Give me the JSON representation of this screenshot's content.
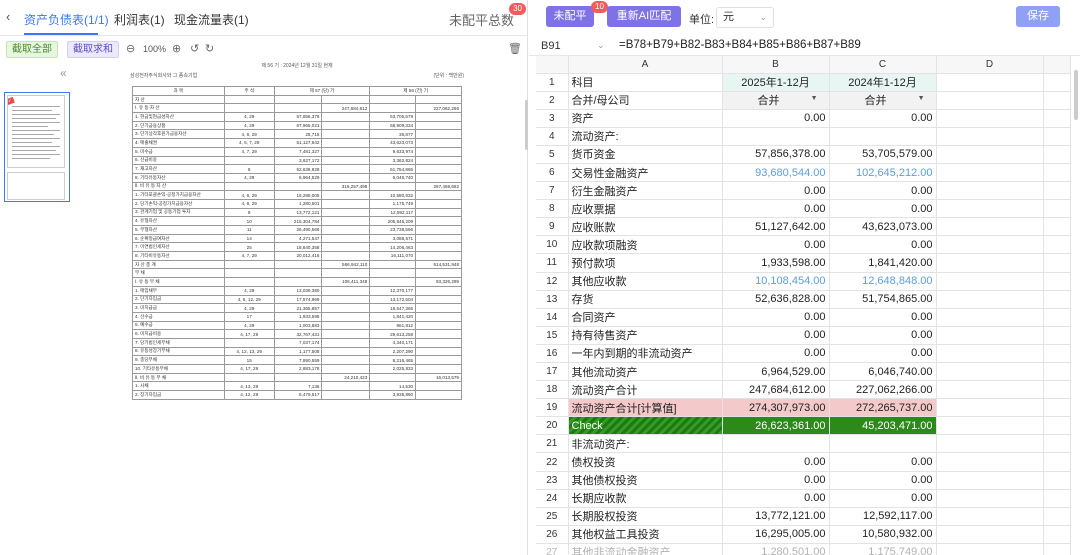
{
  "tabs": [
    {
      "label": "资产负债表(1/1)",
      "active": true
    },
    {
      "label": "利润表(1)",
      "active": false
    },
    {
      "label": "现金流量表(1)",
      "active": false
    }
  ],
  "unbalanced_label": "未配平总数",
  "unbalanced_count": "30",
  "left_toolbar": {
    "btn_all": "截取全部",
    "btn_sum": "截取求和",
    "zoom": "100%"
  },
  "document": {
    "caption": "제 56 기 : 2024년 12월 31일 현재",
    "company": "삼성전자주식회사와 그 종속기업",
    "unit": "(단위 : 백만원)",
    "header": [
      "과          목",
      "주  석",
      "제 57 (당) 기",
      "제 56 (전) 기"
    ],
    "rows": [
      [
        "자          산",
        "",
        "",
        "",
        "",
        ""
      ],
      [
        "Ⅰ. 유 동 자 산",
        "",
        "",
        "247,684,612",
        "",
        "227,062,266"
      ],
      [
        "1. 현금및현금성자산",
        "4, 29",
        "57,856,378",
        "",
        "53,705,579",
        ""
      ],
      [
        "2. 단기금융상품",
        "4, 29",
        "67,965,021",
        "",
        "58,909,334",
        ""
      ],
      [
        "3. 단기상각후원가금융자산",
        "4, 6, 29",
        "25,715",
        "",
        "36,877",
        ""
      ],
      [
        "4. 매출채권",
        "4, 5, 7, 29",
        "51,127,642",
        "",
        "43,623,073",
        ""
      ],
      [
        "5. 미수금",
        "4, 7, 29",
        "7,481,327",
        "",
        "9,633,974",
        ""
      ],
      [
        "6. 선급비용",
        "",
        "3,627,172",
        "",
        "3,362,824",
        ""
      ],
      [
        "7. 재고자산",
        "8",
        "52,636,828",
        "",
        "51,754,865",
        ""
      ],
      [
        "8. 기타유동자산",
        "4, 29",
        "6,964,529",
        "",
        "6,046,740",
        ""
      ],
      [
        "Ⅱ. 비 유 동 자 산",
        "",
        "",
        "319,257,498",
        "",
        "287,469,682"
      ],
      [
        "1. 기타포괄손익-공정가치금융자산",
        "4, 6, 29",
        "16,295,005",
        "",
        "10,580,932",
        ""
      ],
      [
        "2. 당기손익-공정가치금융자산",
        "4, 6, 29",
        "1,280,501",
        "",
        "1,175,749",
        ""
      ],
      [
        "3. 관계기업 및 공동기업 투자",
        "9",
        "13,772,121",
        "",
        "12,592,117",
        ""
      ],
      [
        "4. 유형자산",
        "10",
        "215,304,784",
        "",
        "205,945,209",
        ""
      ],
      [
        "5. 무형자산",
        "11",
        "26,490,566",
        "",
        "23,738,566",
        ""
      ],
      [
        "6. 순확정급여자산",
        "14",
        "4,271,547",
        "",
        "3,088,571",
        ""
      ],
      [
        "7. 이연법인세자산",
        "25",
        "18,840,358",
        "",
        "14,206,463",
        ""
      ],
      [
        "8. 기타비유동자산",
        "4, 7, 29",
        "20,012,416",
        "",
        "16,111,070",
        ""
      ],
      [
        "자  산  총  계",
        "",
        "",
        "566,942,110",
        "",
        "514,531,948"
      ],
      [
        "부          채",
        "",
        "",
        "",
        "",
        ""
      ],
      [
        "Ⅰ. 유 동 부 채",
        "",
        "",
        "106,411,348",
        "",
        "93,326,299"
      ],
      [
        "1. 매입채무",
        "4, 29",
        "13,039,380",
        "",
        "12,370,177",
        ""
      ],
      [
        "2. 단기차입금",
        "4, 5, 12, 29",
        "17,574,969",
        "",
        "13,172,504",
        ""
      ],
      [
        "3. 미지급금",
        "4, 29",
        "21,365,857",
        "",
        "18,547,365",
        ""
      ],
      [
        "4. 선수금",
        "17",
        "1,933,598",
        "",
        "1,841,420",
        ""
      ],
      [
        "5. 예수금",
        "4, 29",
        "1,003,883",
        "",
        "961,812",
        ""
      ],
      [
        "6. 미지급비용",
        "4, 17, 29",
        "32,767,431",
        "",
        "29,613,258",
        ""
      ],
      [
        "7. 당기법인세부채",
        "",
        "7,037,174",
        "",
        "4,340,171",
        ""
      ],
      [
        "8. 유동성장기부채",
        "4, 12, 13, 29",
        "1,177,508",
        "",
        "2,207,290",
        ""
      ],
      [
        "9. 충당부채",
        "15",
        "7,890,559",
        "",
        "8,216,465",
        ""
      ],
      [
        "10. 기타유동부채",
        "4, 17, 29",
        "2,883,178",
        "",
        "2,025,833",
        ""
      ],
      [
        "Ⅱ. 비 유 동 부 채",
        "",
        "",
        "24,210,423",
        "",
        "16,013,579"
      ],
      [
        "1. 사채",
        "4, 13, 29",
        "7,136",
        "",
        "14,530",
        ""
      ],
      [
        "2. 장기차입금",
        "4, 12, 29",
        "6,479,517",
        "",
        "3,935,860",
        ""
      ]
    ]
  },
  "right_toolbar": {
    "unbalanced_btn": "未配平",
    "unbalanced_badge": "10",
    "rematch_btn": "重新AI匹配",
    "unit_label": "单位:",
    "unit_value": "元",
    "save_btn": "保存"
  },
  "formula_bar": {
    "cell_ref": "B91",
    "formula": "=B78+B79+B82-B83+B84+B85+B86+B87+B89"
  },
  "sheet": {
    "columns": [
      "A",
      "B",
      "C",
      "D"
    ],
    "rows": [
      {
        "n": "1",
        "a": "科目",
        "b": "2025年1-12月",
        "c": "2024年1-12月",
        "style": "header"
      },
      {
        "n": "2",
        "a": "合并/母公司",
        "b": "合并",
        "c": "合并",
        "style": "dropdown"
      },
      {
        "n": "3",
        "a": "资产",
        "b": "0.00",
        "c": "0.00"
      },
      {
        "n": "4",
        "a": "流动资产:",
        "b": "",
        "c": ""
      },
      {
        "n": "5",
        "a": "货币资金",
        "b": "57,856,378.00",
        "c": "53,705,579.00"
      },
      {
        "n": "6",
        "a": "交易性金融资产",
        "b": "93,680,544.00",
        "c": "102,645,212.00",
        "style": "blue"
      },
      {
        "n": "7",
        "a": "衍生金融资产",
        "b": "0.00",
        "c": "0.00"
      },
      {
        "n": "8",
        "a": "应收票据",
        "b": "0.00",
        "c": "0.00"
      },
      {
        "n": "9",
        "a": "应收账款",
        "b": "51,127,642.00",
        "c": "43,623,073.00"
      },
      {
        "n": "10",
        "a": "应收款项融资",
        "b": "0.00",
        "c": "0.00"
      },
      {
        "n": "11",
        "a": "预付款项",
        "b": "1,933,598.00",
        "c": "1,841,420.00"
      },
      {
        "n": "12",
        "a": "其他应收款",
        "b": "10,108,454.00",
        "c": "12,648,848.00",
        "style": "blue"
      },
      {
        "n": "13",
        "a": "存货",
        "b": "52,636,828.00",
        "c": "51,754,865.00"
      },
      {
        "n": "14",
        "a": "合同资产",
        "b": "0.00",
        "c": "0.00"
      },
      {
        "n": "15",
        "a": "持有待售资产",
        "b": "0.00",
        "c": "0.00"
      },
      {
        "n": "16",
        "a": "一年内到期的非流动资产",
        "b": "0.00",
        "c": "0.00"
      },
      {
        "n": "17",
        "a": "其他流动资产",
        "b": "6,964,529.00",
        "c": "6,046,740.00"
      },
      {
        "n": "18",
        "a": "流动资产合计",
        "b": "247,684,612.00",
        "c": "227,062,266.00"
      },
      {
        "n": "19",
        "a": "流动资产合计[计算值]",
        "b": "274,307,973.00",
        "c": "272,265,737.00",
        "style": "pink"
      },
      {
        "n": "20",
        "a": "Check",
        "b": "26,623,361.00",
        "c": "45,203,471.00",
        "style": "green"
      },
      {
        "n": "21",
        "a": "非流动资产:",
        "b": "",
        "c": ""
      },
      {
        "n": "22",
        "a": "债权投资",
        "b": "0.00",
        "c": "0.00"
      },
      {
        "n": "23",
        "a": "其他债权投资",
        "b": "0.00",
        "c": "0.00"
      },
      {
        "n": "24",
        "a": "长期应收款",
        "b": "0.00",
        "c": "0.00"
      },
      {
        "n": "25",
        "a": "长期股权投资",
        "b": "13,772,121.00",
        "c": "12,592,117.00"
      },
      {
        "n": "26",
        "a": "其他权益工具投资",
        "b": "16,295,005.00",
        "c": "10,580,932.00"
      },
      {
        "n": "27",
        "a": "其他非流动金融资产",
        "b": "1,280,501.00",
        "c": "1,175,749.00",
        "style": "cut"
      }
    ]
  }
}
